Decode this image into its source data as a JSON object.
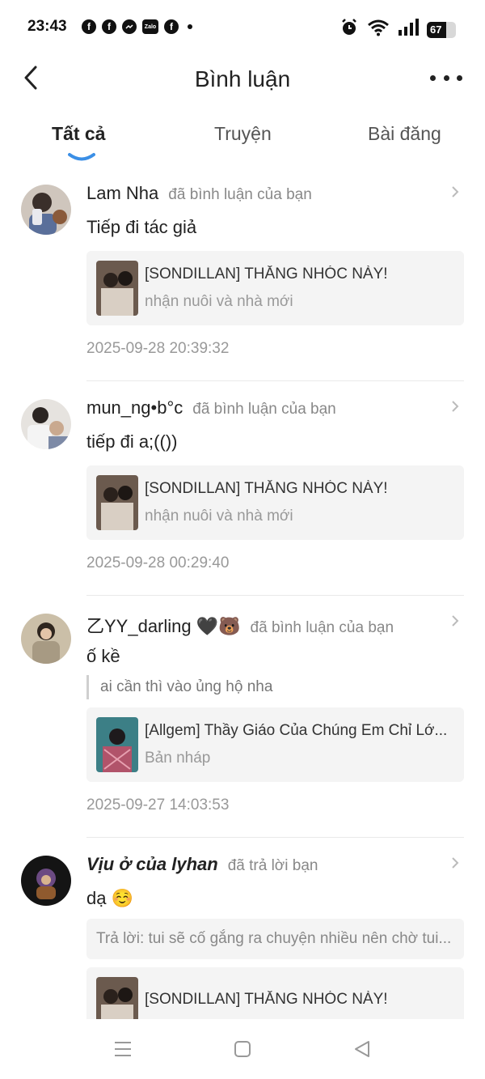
{
  "status_bar": {
    "time": "23:43",
    "notification_icons": [
      "facebook-icon",
      "facebook-icon",
      "messenger-icon",
      "zalo-icon",
      "facebook-icon"
    ],
    "zalo_label": "Zalo",
    "battery_level": "67",
    "system_icons": [
      "alarm-icon",
      "wifi-icon",
      "signal-icon",
      "battery-icon"
    ]
  },
  "header": {
    "title": "Bình luận",
    "back_icon": "chevron-left-icon",
    "more_icon": "more-dots-icon"
  },
  "tabs": [
    {
      "label": "Tất cả",
      "active": true
    },
    {
      "label": "Truyện",
      "active": false
    },
    {
      "label": "Bài đăng",
      "active": false
    }
  ],
  "comments": [
    {
      "user": "Lam Nha",
      "action": "đã bình luận của bạn",
      "text": "Tiếp đi tác giả",
      "card": {
        "title": "[SONDILLAN] THẰNG NHÓC NÀY!",
        "subtitle": "nhận nuôi và nhà mới"
      },
      "time": "2025-09-28 20:39:32"
    },
    {
      "user": "mun_ng•b°c",
      "action": "đã bình luận của bạn",
      "text": "tiếp đi a;(())",
      "card": {
        "title": "[SONDILLAN] THẰNG NHÓC NÀY!",
        "subtitle": "nhận nuôi và nhà mới"
      },
      "time": "2025-09-28 00:29:40"
    },
    {
      "user": "乙YY_darling 🖤🐻",
      "action": "đã bình luận của bạn",
      "text": "ố kề",
      "quote": "ai cần thì vào ủng hộ nha",
      "card": {
        "title": "[Allgem] Thầy Giáo Của Chúng Em Chỉ Lớ...",
        "subtitle": "Bản nháp"
      },
      "time": "2025-09-27 14:03:53"
    },
    {
      "user": "Vịu ở của lyhan",
      "action": "đã trả lời bạn",
      "text": "dạ ☺️",
      "reply": "Trả lời: tui sẽ cố gắng ra chuyện nhiều nên chờ tui...",
      "card": {
        "title": "[SONDILLAN] THẰNG NHÓC NÀY!",
        "subtitle": ""
      }
    }
  ],
  "colors": {
    "accent": "#3b8fe6",
    "secondary_text": "#888888",
    "card_bg": "#f4f4f4"
  },
  "nav": [
    "menu-icon",
    "home-square-icon",
    "back-triangle-icon"
  ]
}
